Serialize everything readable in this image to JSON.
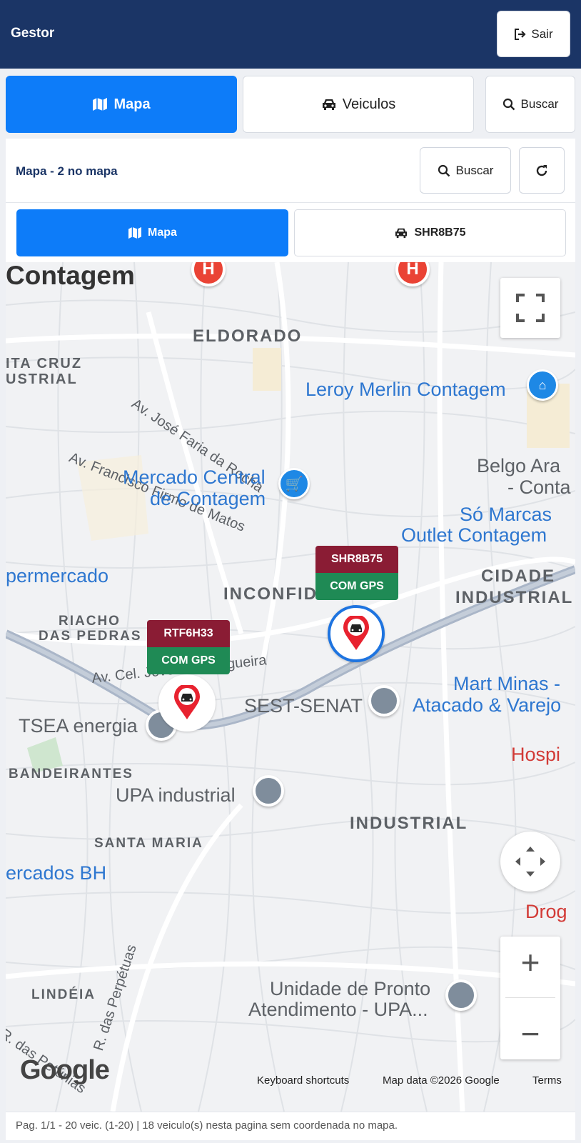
{
  "header": {
    "title": "Gestor",
    "logout_label": "Sair"
  },
  "nav_tabs": [
    {
      "label": "Mapa",
      "icon": "map-icon",
      "active": true
    },
    {
      "label": "Veiculos",
      "icon": "car-icon",
      "active": false
    },
    {
      "label": "Buscar",
      "icon": "search-icon",
      "active": false
    }
  ],
  "panel": {
    "title": "Mapa - 2 no mapa",
    "search_label": "Buscar",
    "refresh_icon": "refresh-icon",
    "sub_tabs": [
      {
        "label": "Mapa",
        "icon": "map-icon",
        "active": true
      },
      {
        "label": "SHR8B75",
        "icon": "car-icon",
        "active": false
      }
    ]
  },
  "map": {
    "districts": [
      "Contagem",
      "ELDORADO",
      "ITA CRUZ",
      "USTRIAL",
      "INCONFIDENTES",
      "CIDADE",
      "INDUSTRIAL",
      "RIACHO",
      "DAS PEDRAS",
      "BANDEIRANTES",
      "INDUSTRIAL",
      "SANTA MARIA",
      "LINDÉIA"
    ],
    "streets": [
      "Av. José Faria da Rocha",
      "Av. Francisco Firmo de Matos",
      "Av. Cel. Jové... es Nogueira",
      "R. das Perpétuas",
      "R. das Petúnias"
    ],
    "places": [
      "Leroy Merlin Contagem",
      "Mercado Central",
      "de Contagem",
      "Belgo Ara",
      "- Conta",
      "Só Marcas",
      "Outlet Contagem",
      "permercado",
      "Mart Minas -",
      "Atacado & Varejo",
      "SEST-SENAT",
      "TSEA energia",
      "UPA industrial",
      "ercados BH",
      "Unidade de Pronto",
      "Atendimento -  UPA...",
      "Hospi",
      "Drog"
    ],
    "vehicles": [
      {
        "plate": "SHR8B75",
        "status": "COM GPS",
        "selected": true
      },
      {
        "plate": "RTF6H33",
        "status": "COM GPS",
        "selected": false
      }
    ],
    "zoom_in": "+",
    "zoom_out": "−",
    "logo": "Google",
    "attribution": {
      "shortcuts": "Keyboard shortcuts",
      "data": "Map data ©2026 Google",
      "terms": "Terms"
    },
    "colors": {
      "vehicle_tag": "#8a1c34",
      "gps_tag": "#1f8a55",
      "hospital_pin": "#ea4335",
      "poi_text": "#2e77d0"
    }
  },
  "footer": {
    "text": "Pag. 1/1 - 20 veic. (1-20) | 18 veiculo(s) nesta pagina sem coordenada no mapa."
  }
}
